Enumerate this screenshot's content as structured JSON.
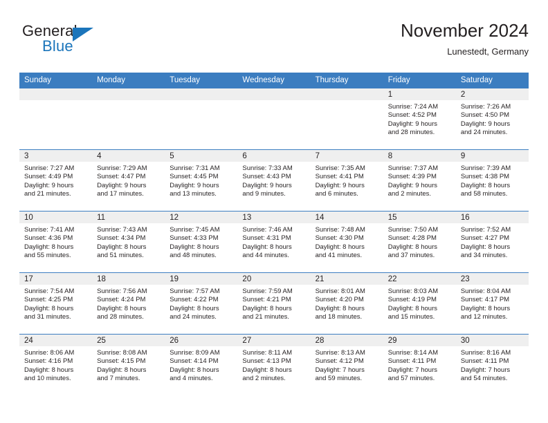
{
  "brand": {
    "word1": "General",
    "word2": "Blue",
    "flag_icon": "triangle-flag-icon",
    "accent_color": "#1b75bb"
  },
  "header": {
    "title": "November 2024",
    "location": "Lunestedt, Germany"
  },
  "theme": {
    "header_bg": "#3b7dc0",
    "daynum_bg": "#efefef",
    "text": "#231f20"
  },
  "calendar": {
    "weekday_headers": [
      "Sunday",
      "Monday",
      "Tuesday",
      "Wednesday",
      "Thursday",
      "Friday",
      "Saturday"
    ],
    "weeks": [
      [
        {
          "day": "",
          "empty": true
        },
        {
          "day": "",
          "empty": true
        },
        {
          "day": "",
          "empty": true
        },
        {
          "day": "",
          "empty": true
        },
        {
          "day": "",
          "empty": true
        },
        {
          "day": "1",
          "sunrise": "Sunrise: 7:24 AM",
          "sunset": "Sunset: 4:52 PM",
          "daylight1": "Daylight: 9 hours",
          "daylight2": "and 28 minutes."
        },
        {
          "day": "2",
          "sunrise": "Sunrise: 7:26 AM",
          "sunset": "Sunset: 4:50 PM",
          "daylight1": "Daylight: 9 hours",
          "daylight2": "and 24 minutes."
        }
      ],
      [
        {
          "day": "3",
          "sunrise": "Sunrise: 7:27 AM",
          "sunset": "Sunset: 4:49 PM",
          "daylight1": "Daylight: 9 hours",
          "daylight2": "and 21 minutes."
        },
        {
          "day": "4",
          "sunrise": "Sunrise: 7:29 AM",
          "sunset": "Sunset: 4:47 PM",
          "daylight1": "Daylight: 9 hours",
          "daylight2": "and 17 minutes."
        },
        {
          "day": "5",
          "sunrise": "Sunrise: 7:31 AM",
          "sunset": "Sunset: 4:45 PM",
          "daylight1": "Daylight: 9 hours",
          "daylight2": "and 13 minutes."
        },
        {
          "day": "6",
          "sunrise": "Sunrise: 7:33 AM",
          "sunset": "Sunset: 4:43 PM",
          "daylight1": "Daylight: 9 hours",
          "daylight2": "and 9 minutes."
        },
        {
          "day": "7",
          "sunrise": "Sunrise: 7:35 AM",
          "sunset": "Sunset: 4:41 PM",
          "daylight1": "Daylight: 9 hours",
          "daylight2": "and 6 minutes."
        },
        {
          "day": "8",
          "sunrise": "Sunrise: 7:37 AM",
          "sunset": "Sunset: 4:39 PM",
          "daylight1": "Daylight: 9 hours",
          "daylight2": "and 2 minutes."
        },
        {
          "day": "9",
          "sunrise": "Sunrise: 7:39 AM",
          "sunset": "Sunset: 4:38 PM",
          "daylight1": "Daylight: 8 hours",
          "daylight2": "and 58 minutes."
        }
      ],
      [
        {
          "day": "10",
          "sunrise": "Sunrise: 7:41 AM",
          "sunset": "Sunset: 4:36 PM",
          "daylight1": "Daylight: 8 hours",
          "daylight2": "and 55 minutes."
        },
        {
          "day": "11",
          "sunrise": "Sunrise: 7:43 AM",
          "sunset": "Sunset: 4:34 PM",
          "daylight1": "Daylight: 8 hours",
          "daylight2": "and 51 minutes."
        },
        {
          "day": "12",
          "sunrise": "Sunrise: 7:45 AM",
          "sunset": "Sunset: 4:33 PM",
          "daylight1": "Daylight: 8 hours",
          "daylight2": "and 48 minutes."
        },
        {
          "day": "13",
          "sunrise": "Sunrise: 7:46 AM",
          "sunset": "Sunset: 4:31 PM",
          "daylight1": "Daylight: 8 hours",
          "daylight2": "and 44 minutes."
        },
        {
          "day": "14",
          "sunrise": "Sunrise: 7:48 AM",
          "sunset": "Sunset: 4:30 PM",
          "daylight1": "Daylight: 8 hours",
          "daylight2": "and 41 minutes."
        },
        {
          "day": "15",
          "sunrise": "Sunrise: 7:50 AM",
          "sunset": "Sunset: 4:28 PM",
          "daylight1": "Daylight: 8 hours",
          "daylight2": "and 37 minutes."
        },
        {
          "day": "16",
          "sunrise": "Sunrise: 7:52 AM",
          "sunset": "Sunset: 4:27 PM",
          "daylight1": "Daylight: 8 hours",
          "daylight2": "and 34 minutes."
        }
      ],
      [
        {
          "day": "17",
          "sunrise": "Sunrise: 7:54 AM",
          "sunset": "Sunset: 4:25 PM",
          "daylight1": "Daylight: 8 hours",
          "daylight2": "and 31 minutes."
        },
        {
          "day": "18",
          "sunrise": "Sunrise: 7:56 AM",
          "sunset": "Sunset: 4:24 PM",
          "daylight1": "Daylight: 8 hours",
          "daylight2": "and 28 minutes."
        },
        {
          "day": "19",
          "sunrise": "Sunrise: 7:57 AM",
          "sunset": "Sunset: 4:22 PM",
          "daylight1": "Daylight: 8 hours",
          "daylight2": "and 24 minutes."
        },
        {
          "day": "20",
          "sunrise": "Sunrise: 7:59 AM",
          "sunset": "Sunset: 4:21 PM",
          "daylight1": "Daylight: 8 hours",
          "daylight2": "and 21 minutes."
        },
        {
          "day": "21",
          "sunrise": "Sunrise: 8:01 AM",
          "sunset": "Sunset: 4:20 PM",
          "daylight1": "Daylight: 8 hours",
          "daylight2": "and 18 minutes."
        },
        {
          "day": "22",
          "sunrise": "Sunrise: 8:03 AM",
          "sunset": "Sunset: 4:19 PM",
          "daylight1": "Daylight: 8 hours",
          "daylight2": "and 15 minutes."
        },
        {
          "day": "23",
          "sunrise": "Sunrise: 8:04 AM",
          "sunset": "Sunset: 4:17 PM",
          "daylight1": "Daylight: 8 hours",
          "daylight2": "and 12 minutes."
        }
      ],
      [
        {
          "day": "24",
          "sunrise": "Sunrise: 8:06 AM",
          "sunset": "Sunset: 4:16 PM",
          "daylight1": "Daylight: 8 hours",
          "daylight2": "and 10 minutes."
        },
        {
          "day": "25",
          "sunrise": "Sunrise: 8:08 AM",
          "sunset": "Sunset: 4:15 PM",
          "daylight1": "Daylight: 8 hours",
          "daylight2": "and 7 minutes."
        },
        {
          "day": "26",
          "sunrise": "Sunrise: 8:09 AM",
          "sunset": "Sunset: 4:14 PM",
          "daylight1": "Daylight: 8 hours",
          "daylight2": "and 4 minutes."
        },
        {
          "day": "27",
          "sunrise": "Sunrise: 8:11 AM",
          "sunset": "Sunset: 4:13 PM",
          "daylight1": "Daylight: 8 hours",
          "daylight2": "and 2 minutes."
        },
        {
          "day": "28",
          "sunrise": "Sunrise: 8:13 AM",
          "sunset": "Sunset: 4:12 PM",
          "daylight1": "Daylight: 7 hours",
          "daylight2": "and 59 minutes."
        },
        {
          "day": "29",
          "sunrise": "Sunrise: 8:14 AM",
          "sunset": "Sunset: 4:11 PM",
          "daylight1": "Daylight: 7 hours",
          "daylight2": "and 57 minutes."
        },
        {
          "day": "30",
          "sunrise": "Sunrise: 8:16 AM",
          "sunset": "Sunset: 4:11 PM",
          "daylight1": "Daylight: 7 hours",
          "daylight2": "and 54 minutes."
        }
      ]
    ]
  }
}
